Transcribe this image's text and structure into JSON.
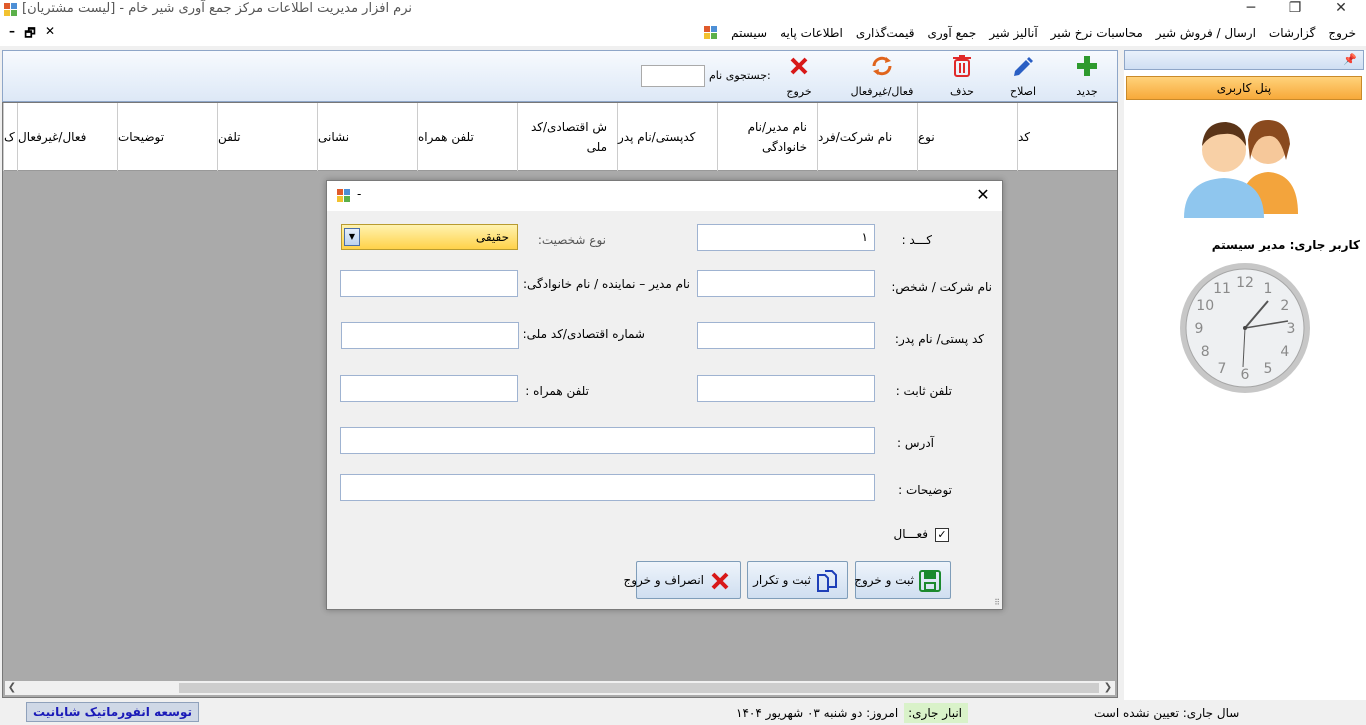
{
  "window": {
    "title": "نرم افزار مدیریت اطلاعات مرکز جمع آوری شیر خام - [لیست مشتریان]",
    "minimize": "─",
    "maximize": "❐",
    "close": "✕"
  },
  "menu": {
    "items": [
      "سیستم",
      "اطلاعات پایه",
      "قیمت‌گذاری",
      "جمع آوری",
      "آنالیز شیر",
      "محاسبات نرخ شیر",
      "ارسال / فروش شیر",
      "گزارشات",
      "خروج"
    ],
    "mdi_minimize": "–",
    "mdi_restore": "🗗",
    "mdi_close": "✕"
  },
  "toolbar": {
    "new": "جدید",
    "edit": "اصلاح",
    "delete": "حذف",
    "toggle": "فعال/غیرفعال",
    "exit": "خروج",
    "search_label": "جستجوی نام:"
  },
  "grid": {
    "columns": [
      "کد",
      "نوع",
      "نام شرکت/فرد",
      "نام مدیر/نام خانوادگی",
      "کدپستی/نام پدر",
      "ش اقتصادی/کد ملی",
      "تلفن همراه",
      "نشانی",
      "تلفن",
      "توضیحات",
      "فعال/غیرفعال",
      "ک"
    ]
  },
  "side_panel": {
    "title": "پنل کاربری",
    "pin": "📌",
    "current_user": "کاربر جاری: مدیر سیستم",
    "clock_numbers": [
      "12",
      "1",
      "2",
      "3",
      "4",
      "5",
      "6",
      "7",
      "8",
      "9",
      "10",
      "11"
    ]
  },
  "dialog": {
    "title": "-",
    "close": "✕",
    "code_label": "کـــد :",
    "code_value": "۱",
    "person_type_label": "نوع شخصیت:",
    "person_type_value": "حقیقی",
    "company_label": "نام شرکت / شخص:",
    "manager_label": "نام مدیر – نماینده / نام خانوادگی:",
    "postal_label": "کد پستی/ نام پدر:",
    "economic_label": "شماره اقتصادی/کد ملی:",
    "phone_label": "تلفن ثابت :",
    "mobile_label": "تلفن همراه :",
    "address_label": "آدرس :",
    "notes_label": "توضیحات :",
    "active_label": "فعـــال",
    "active_checked": "✓",
    "save_exit": "ثبت و خروج",
    "save_repeat": "ثبت و تکرار",
    "cancel_exit": "انصراف و خروج"
  },
  "status": {
    "year": "سال جاری: تعیین نشده است",
    "warehouse": "انبار جاری:",
    "today": "امروز: دو شنبه ۰۳ شهریور ۱۴۰۴",
    "company": "توسعه انفورماتیک شایانیت"
  },
  "colors": {
    "accent_orange": "#f7a93a",
    "toolbar_blue": "#dde8f6",
    "status_green": "#d9f2c9",
    "combo_yellow": "#ffd24a"
  }
}
